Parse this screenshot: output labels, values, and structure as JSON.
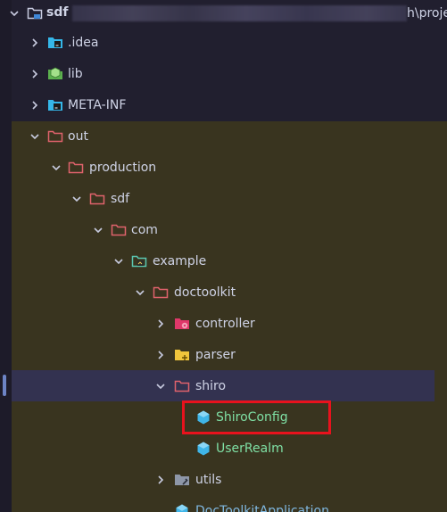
{
  "tree": {
    "root": {
      "label": "sdf",
      "path_tail": "h\\projec"
    },
    "items": [
      {
        "label": ".idea"
      },
      {
        "label": "lib"
      },
      {
        "label": "META-INF"
      },
      {
        "label": "out"
      },
      {
        "label": "production"
      },
      {
        "label": "sdf"
      },
      {
        "label": "com"
      },
      {
        "label": "example"
      },
      {
        "label": "doctoolkit"
      },
      {
        "label": "controller"
      },
      {
        "label": "parser"
      },
      {
        "label": "shiro"
      },
      {
        "label": "ShiroConfig"
      },
      {
        "label": "UserRealm"
      },
      {
        "label": "utils"
      },
      {
        "label": "DocToolkitApplication"
      }
    ]
  },
  "colors": {
    "background": "#211f2f",
    "excluded_background": "#39341f",
    "selection": "#333250",
    "folder_outline": "#e0626c",
    "class_icon": "#3fb5e8",
    "highlight_box": "#e8121d"
  }
}
